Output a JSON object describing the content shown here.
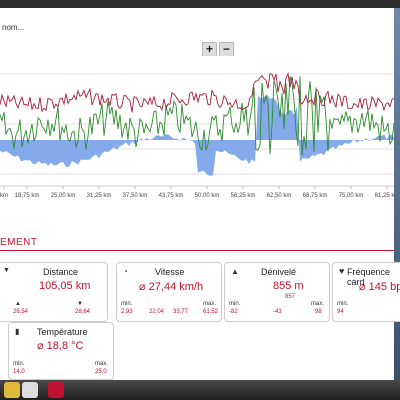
{
  "name_field": "nom...",
  "zoom": {
    "plus": "+",
    "minus": "−"
  },
  "x_ticks": [
    "18,75 km",
    "25,00 km",
    "31,25 km",
    "37,50 km",
    "43,75 km",
    "50,00 km",
    "56,25 km",
    "62,50 km",
    "68,75 km",
    "75,00 km",
    "81,25 km"
  ],
  "left_tick": "km",
  "section_title": "EMENT",
  "cards": {
    "distance": {
      "title": "Distance",
      "value": "105,05 km",
      "left": "26,54",
      "right": "28,64"
    },
    "speed": {
      "title": "Vitesse",
      "value": "⌀ 27,44 km/h",
      "min_label": "min.",
      "max_label": "max.",
      "v1": "2,93",
      "v2": "22,04",
      "v3": "33,77",
      "v4": "61,52"
    },
    "elevation": {
      "title": "Dénivelé",
      "value": "855 m",
      "sub": "857",
      "min_label": "min.",
      "max_label": "max.",
      "v1": "-82",
      "v2": "-43",
      "v3": "98"
    },
    "heart": {
      "title": "Fréquence card",
      "value": "⌀ 145 bp",
      "min_label": "min.",
      "v1": "94"
    },
    "temperature": {
      "title": "Température",
      "value": "⌀ 18,8 °C",
      "min_label": "min.",
      "max_label": "max.",
      "v1": "14,0",
      "v2": "25,0"
    },
    "left_small": {
      "v1": "2,08"
    }
  },
  "colors": {
    "accent": "#c3122f",
    "area": "#6f9be8",
    "green": "#2e8b2e",
    "red_line": "#a0213a"
  }
}
